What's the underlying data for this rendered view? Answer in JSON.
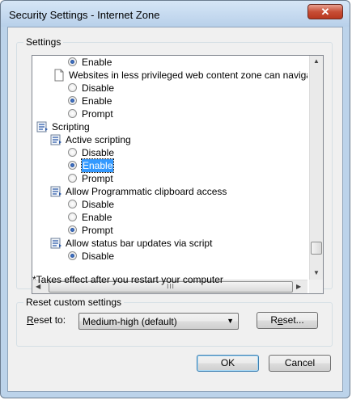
{
  "window": {
    "title": "Security Settings - Internet Zone",
    "close_label": "✕"
  },
  "settings_group": {
    "label": "Settings"
  },
  "list_rows": [
    {
      "kind": "radio",
      "label": "Enable",
      "checked": true
    },
    {
      "kind": "item",
      "label": "Websites in less privileged web content zone can navigate in",
      "icon": "page-icon"
    },
    {
      "kind": "radio",
      "label": "Disable",
      "checked": false
    },
    {
      "kind": "radio",
      "label": "Enable",
      "checked": true
    },
    {
      "kind": "radio",
      "label": "Prompt",
      "checked": false
    },
    {
      "kind": "category",
      "label": "Scripting",
      "icon": "script-icon"
    },
    {
      "kind": "subitem",
      "label": "Active scripting",
      "icon": "script-icon"
    },
    {
      "kind": "radio",
      "label": "Disable",
      "checked": false
    },
    {
      "kind": "radio",
      "label": "Enable",
      "checked": true,
      "selected": true
    },
    {
      "kind": "radio",
      "label": "Prompt",
      "checked": false
    },
    {
      "kind": "subitem",
      "label": "Allow Programmatic clipboard access",
      "icon": "script-icon"
    },
    {
      "kind": "radio",
      "label": "Disable",
      "checked": false
    },
    {
      "kind": "radio",
      "label": "Enable",
      "checked": false
    },
    {
      "kind": "radio",
      "label": "Prompt",
      "checked": true
    },
    {
      "kind": "subitem",
      "label": "Allow status bar updates via script",
      "icon": "script-icon"
    },
    {
      "kind": "radio",
      "label": "Disable",
      "checked": true
    }
  ],
  "note": "*Takes effect after you restart your computer",
  "reset_group": {
    "label": "Reset custom settings",
    "reset_to_prefix": "R",
    "reset_to_rest": "eset to:",
    "selected_value": "Medium-high (default)",
    "reset_button_prefix": "R",
    "reset_button_u": "e",
    "reset_button_rest": "set..."
  },
  "buttons": {
    "ok": "OK",
    "cancel": "Cancel"
  },
  "scroll": {
    "h_thumb_grip": "III"
  }
}
